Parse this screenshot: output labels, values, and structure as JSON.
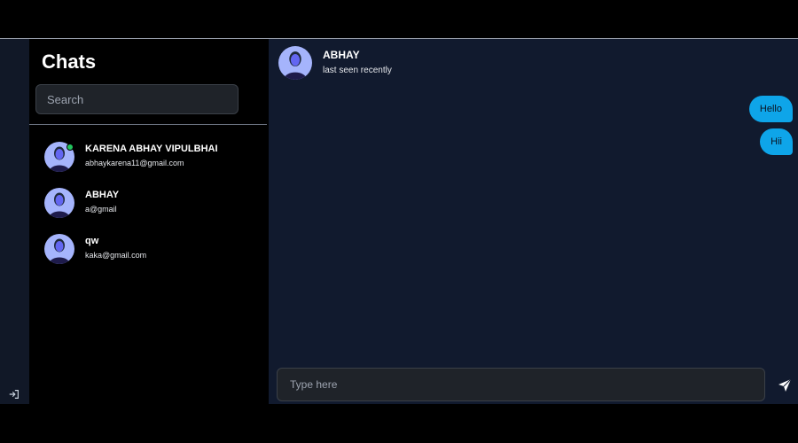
{
  "sidebar": {
    "title": "Chats",
    "search_placeholder": "Search",
    "contacts": [
      {
        "name": "KARENA ABHAY VIPULBHAI",
        "email": "abhaykarena11@gmail.com",
        "online": true
      },
      {
        "name": "ABHAY",
        "email": "a@gmail",
        "online": false
      },
      {
        "name": "qw",
        "email": "kaka@gmail.com",
        "online": false
      }
    ]
  },
  "chat": {
    "name": "ABHAY",
    "status": "last seen recently",
    "messages": [
      {
        "text": "Hello",
        "from": "me"
      },
      {
        "text": "Hii",
        "from": "me"
      }
    ],
    "input_placeholder": "Type here"
  },
  "colors": {
    "bubble": "#0ea5e9",
    "online": "#22c55e",
    "chat_bg": "#111a2e"
  },
  "icons": {
    "logout": "logout-icon",
    "send": "send-icon"
  }
}
